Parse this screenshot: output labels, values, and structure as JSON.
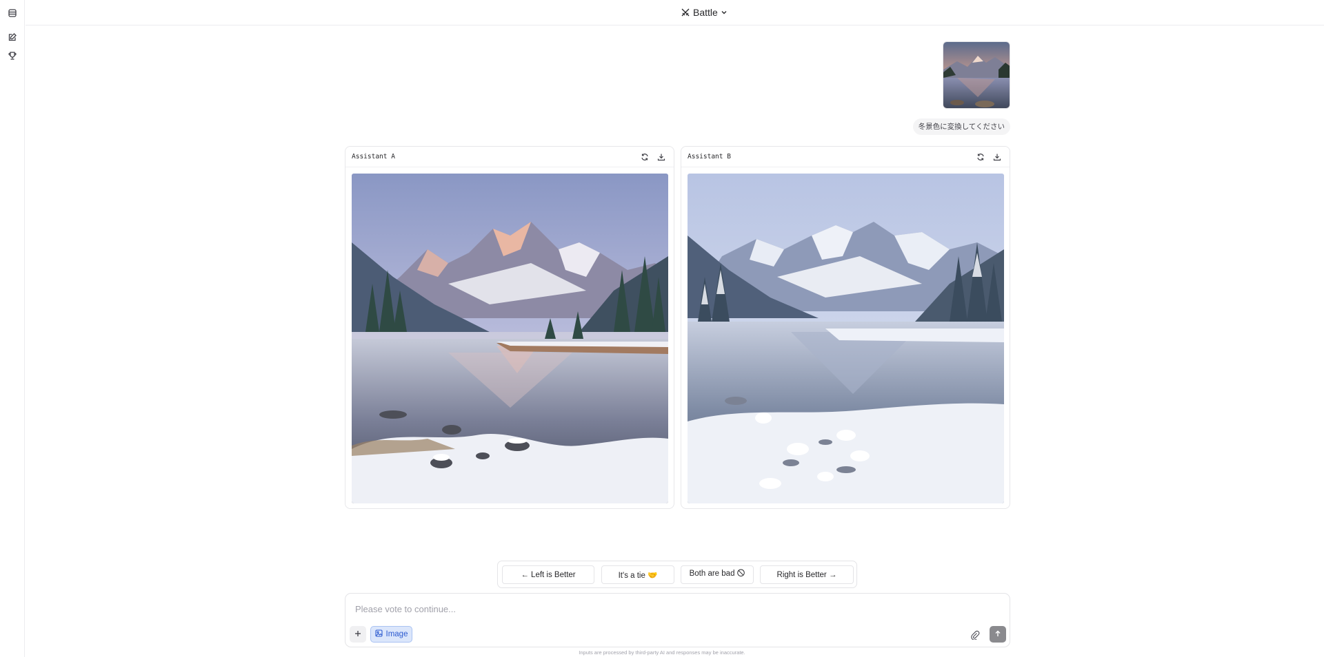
{
  "header": {
    "mode_label": "Battle"
  },
  "sidebar": {
    "items": [
      {
        "name": "table-icon"
      },
      {
        "name": "new-chat-icon"
      },
      {
        "name": "trophy-icon"
      }
    ]
  },
  "conversation": {
    "user_message": "冬景色に変換してください"
  },
  "panels": [
    {
      "title": "Assistant A"
    },
    {
      "title": "Assistant B"
    }
  ],
  "vote": {
    "left_better": "← Left is Better",
    "tie": "It's a tie 🤝",
    "both_bad": "Both are bad 🛇",
    "right_better": "Right is Better →"
  },
  "composer": {
    "placeholder": "Please vote to continue...",
    "image_label": "Image"
  },
  "footer": {
    "disclaimer": "Inputs are processed by third-party AI and responses may be inaccurate."
  },
  "colors": {
    "accent": "#2d5bd0",
    "accent_bg": "#dbe6fb",
    "send_disabled": "#8a8a8e"
  }
}
